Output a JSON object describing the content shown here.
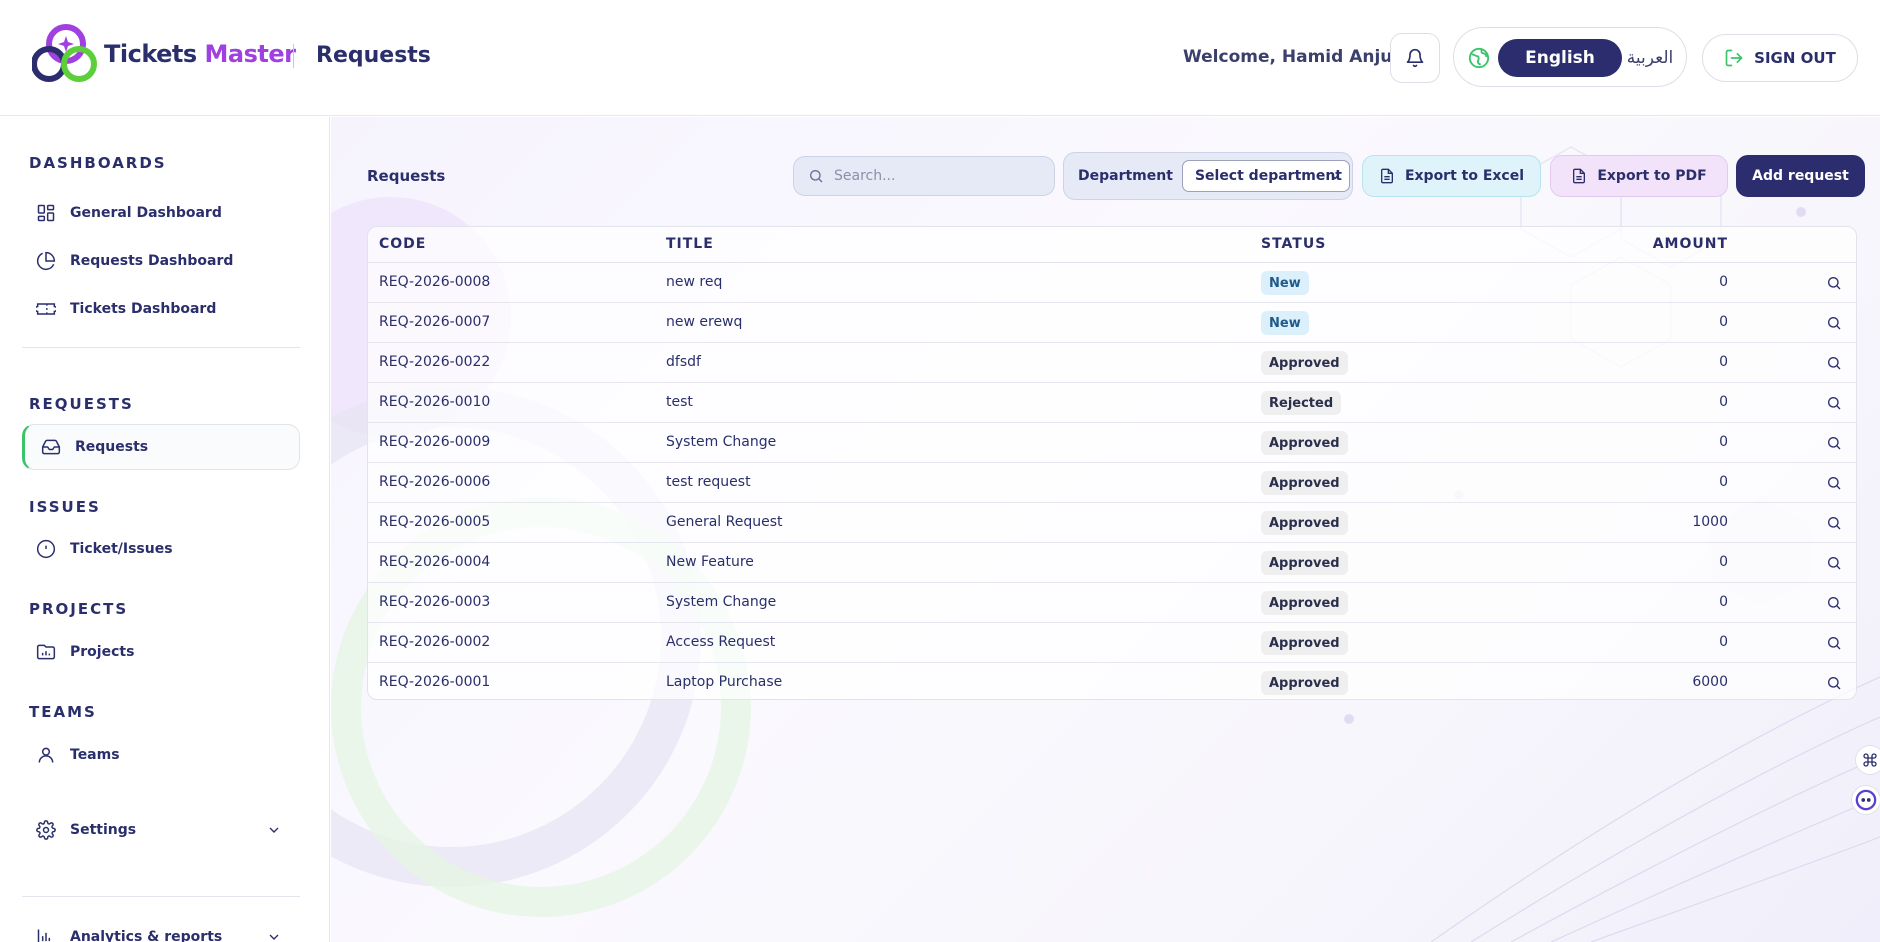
{
  "header": {
    "brand_main": "Tickets ",
    "brand_accent": "Master",
    "page_title": "Requests",
    "welcome": "Welcome, Hamid Anjum",
    "lang_en": "English",
    "lang_ar": "العربية",
    "sign_out": "SIGN OUT"
  },
  "sidebar": {
    "sections": {
      "dashboards": "DASHBOARDS",
      "requests": "REQUESTS",
      "issues": "ISSUES",
      "projects": "PROJECTS",
      "teams": "TEAMS"
    },
    "items": {
      "general_dashboard": "General Dashboard",
      "requests_dashboard": "Requests Dashboard",
      "tickets_dashboard": "Tickets Dashboard",
      "requests": "Requests",
      "ticket_issues": "Ticket/Issues",
      "projects": "Projects",
      "teams": "Teams",
      "settings": "Settings",
      "analytics": "Analytics & reports"
    }
  },
  "toolbar": {
    "title": "Requests",
    "search_placeholder": "Search...",
    "department_label": "Department",
    "department_value": "Select department",
    "export_excel": "Export to Excel",
    "export_pdf": "Export to PDF",
    "add_request": "Add request"
  },
  "table": {
    "columns": [
      "CODE",
      "TITLE",
      "STATUS",
      "AMOUNT"
    ],
    "rows": [
      {
        "code": "REQ-2026-0008",
        "title": "new req",
        "status": "New",
        "amount": "0"
      },
      {
        "code": "REQ-2026-0007",
        "title": "new erewq",
        "status": "New",
        "amount": "0"
      },
      {
        "code": "REQ-2026-0022",
        "title": "dfsdf",
        "status": "Approved",
        "amount": "0"
      },
      {
        "code": "REQ-2026-0010",
        "title": "test",
        "status": "Rejected",
        "amount": "0"
      },
      {
        "code": "REQ-2026-0009",
        "title": "System Change",
        "status": "Approved",
        "amount": "0"
      },
      {
        "code": "REQ-2026-0006",
        "title": "test request",
        "status": "Approved",
        "amount": "0"
      },
      {
        "code": "REQ-2026-0005",
        "title": "General Request",
        "status": "Approved",
        "amount": "1000"
      },
      {
        "code": "REQ-2026-0004",
        "title": "New Feature",
        "status": "Approved",
        "amount": "0"
      },
      {
        "code": "REQ-2026-0003",
        "title": "System Change",
        "status": "Approved",
        "amount": "0"
      },
      {
        "code": "REQ-2026-0002",
        "title": "Access Request",
        "status": "Approved",
        "amount": "0"
      },
      {
        "code": "REQ-2026-0001",
        "title": "Laptop Purchase",
        "status": "Approved",
        "amount": "6000"
      }
    ]
  },
  "colors": {
    "primary": "#2b2d6e",
    "accent_purple": "#a040e0",
    "accent_green": "#39c46a"
  }
}
